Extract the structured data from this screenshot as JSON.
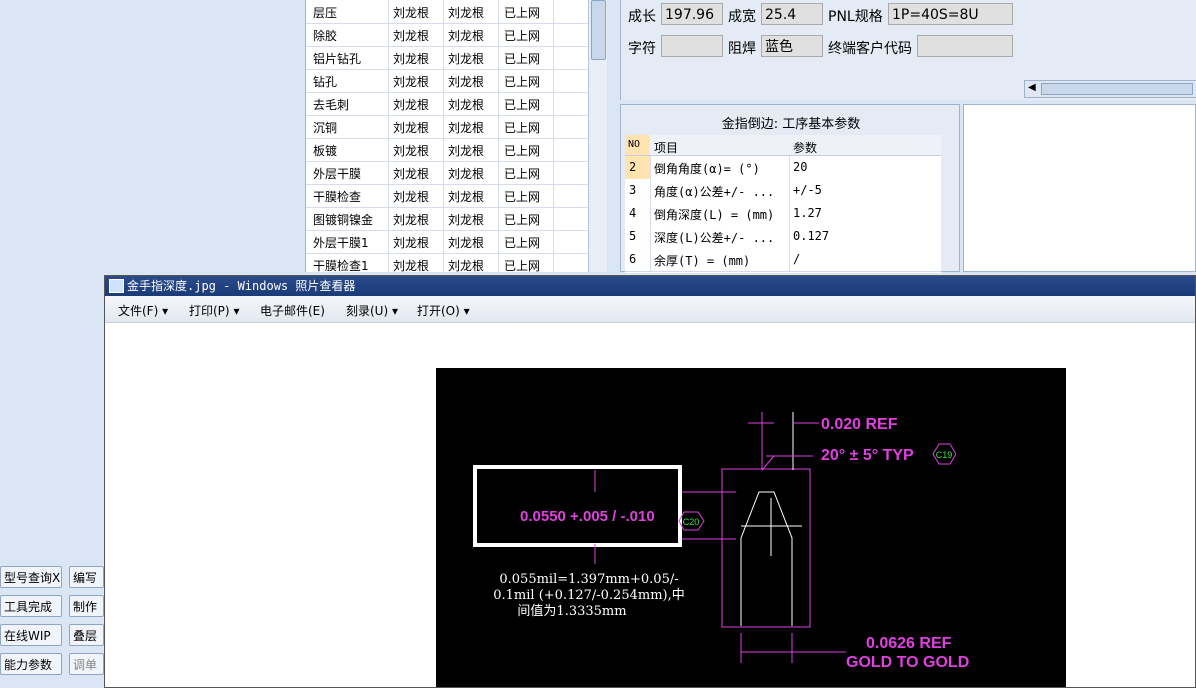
{
  "process_table": {
    "rows": [
      {
        "name": "层压",
        "c1": "刘龙根",
        "c2": "刘龙根",
        "status": "已上网"
      },
      {
        "name": "除胶",
        "c1": "刘龙根",
        "c2": "刘龙根",
        "status": "已上网"
      },
      {
        "name": "铝片钻孔",
        "c1": "刘龙根",
        "c2": "刘龙根",
        "status": "已上网"
      },
      {
        "name": "钻孔",
        "c1": "刘龙根",
        "c2": "刘龙根",
        "status": "已上网"
      },
      {
        "name": "去毛刺",
        "c1": "刘龙根",
        "c2": "刘龙根",
        "status": "已上网"
      },
      {
        "name": "沉铜",
        "c1": "刘龙根",
        "c2": "刘龙根",
        "status": "已上网"
      },
      {
        "name": "板镀",
        "c1": "刘龙根",
        "c2": "刘龙根",
        "status": "已上网"
      },
      {
        "name": "外层干膜",
        "c1": "刘龙根",
        "c2": "刘龙根",
        "status": "已上网"
      },
      {
        "name": "干膜检查",
        "c1": "刘龙根",
        "c2": "刘龙根",
        "status": "已上网"
      },
      {
        "name": "图镀铜镍金",
        "c1": "刘龙根",
        "c2": "刘龙根",
        "status": "已上网"
      },
      {
        "name": "外层干膜1",
        "c1": "刘龙根",
        "c2": "刘龙根",
        "status": "已上网"
      },
      {
        "name": "干膜检查1",
        "c1": "刘龙根",
        "c2": "刘龙根",
        "status": "已上网"
      }
    ]
  },
  "info": {
    "length_label": "成长",
    "length_value": "197.96",
    "width_label": "成宽",
    "width_value": "25.4",
    "pnl_label": "PNL规格",
    "pnl_value": "1P=40S=8U",
    "char_label": "字符",
    "char_value": "",
    "mask_label": "阻焊",
    "mask_value": "蓝色",
    "cust_label": "终端客户代码",
    "cust_value": ""
  },
  "params": {
    "title": "金指倒边: 工序基本参数",
    "headers": {
      "no": "NO",
      "item": "项目",
      "value": "参数"
    },
    "rows": [
      {
        "no": "2",
        "item": "倒角角度(α)=  (°)",
        "value": "20"
      },
      {
        "no": "3",
        "item": "角度(α)公差+/- ...",
        "value": "+/-5"
      },
      {
        "no": "4",
        "item": "倒角深度(L) =  (mm)",
        "value": "1.27"
      },
      {
        "no": "5",
        "item": "深度(L)公差+/- ...",
        "value": "0.127"
      },
      {
        "no": "6",
        "item": "余厚(T) =  (mm)",
        "value": "/"
      }
    ]
  },
  "left_buttons": [
    {
      "label": "型号查询X"
    },
    {
      "label": "编写"
    },
    {
      "label": "工具完成"
    },
    {
      "label": "制作"
    },
    {
      "label": "在线WIP"
    },
    {
      "label": "叠层"
    },
    {
      "label": "能力参数"
    },
    {
      "label": "调单"
    }
  ],
  "viewer": {
    "title": "金手指深度.jpg - Windows 照片查看器",
    "menu": [
      {
        "label": "文件(F)"
      },
      {
        "label": "打印(P)"
      },
      {
        "label": "电子邮件(E)"
      },
      {
        "label": "刻录(U)"
      },
      {
        "label": "打开(O)"
      }
    ],
    "drawing": {
      "ref1": "0.020 REF",
      "angle": "20° ± 5° TYP",
      "tag1": "C19",
      "depth": "0.0550 +.005 / -.010",
      "tag2": "C20",
      "note1": "0.055mil=1.397mm+0.05/-",
      "note2": "0.1mil (+0.127/-0.254mm),中",
      "note3": "间值为1.3335mm",
      "ref2": "0.0626 REF",
      "ref3": "GOLD TO GOLD"
    }
  },
  "colors": {
    "accent": "#1b3a78",
    "magenta": "#e040e0",
    "panel": "#e4ebf5"
  }
}
